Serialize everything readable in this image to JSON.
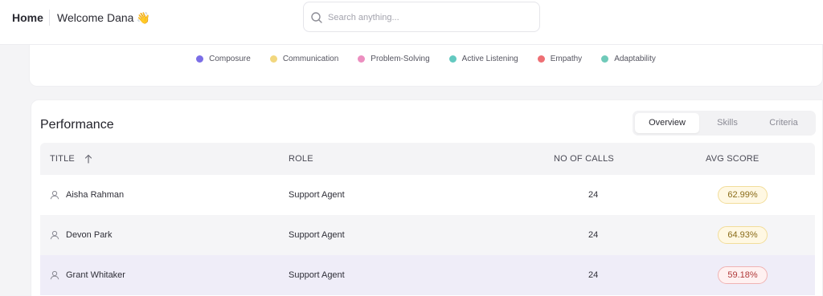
{
  "header": {
    "home_label": "Home",
    "welcome_text": "Welcome Dana",
    "welcome_emoji": "👋",
    "search_placeholder": "Search anything..."
  },
  "legend": {
    "items": [
      {
        "label": "Composure",
        "color": "#7b6ee6"
      },
      {
        "label": "Communication",
        "color": "#f2d77e"
      },
      {
        "label": "Problem-Solving",
        "color": "#ec8fc0"
      },
      {
        "label": "Active Listening",
        "color": "#63c9c0"
      },
      {
        "label": "Empathy",
        "color": "#ee6f74"
      },
      {
        "label": "Adaptability",
        "color": "#6fcab9"
      }
    ]
  },
  "performance": {
    "title": "Performance",
    "tabs": [
      {
        "label": "Overview",
        "active": true
      },
      {
        "label": "Skills",
        "active": false
      },
      {
        "label": "Criteria",
        "active": false
      }
    ],
    "columns": {
      "title": "TITLE",
      "role": "ROLE",
      "calls": "NO OF CALLS",
      "score": "AVG SCORE"
    },
    "rows": [
      {
        "name": "Aisha Rahman",
        "role": "Support Agent",
        "calls": "24",
        "score": "62.99%",
        "score_status": "ok"
      },
      {
        "name": "Devon Park",
        "role": "Support Agent",
        "calls": "24",
        "score": "64.93%",
        "score_status": "ok"
      },
      {
        "name": "Grant Whitaker",
        "role": "Support Agent",
        "calls": "24",
        "score": "59.18%",
        "score_status": "low"
      }
    ]
  }
}
